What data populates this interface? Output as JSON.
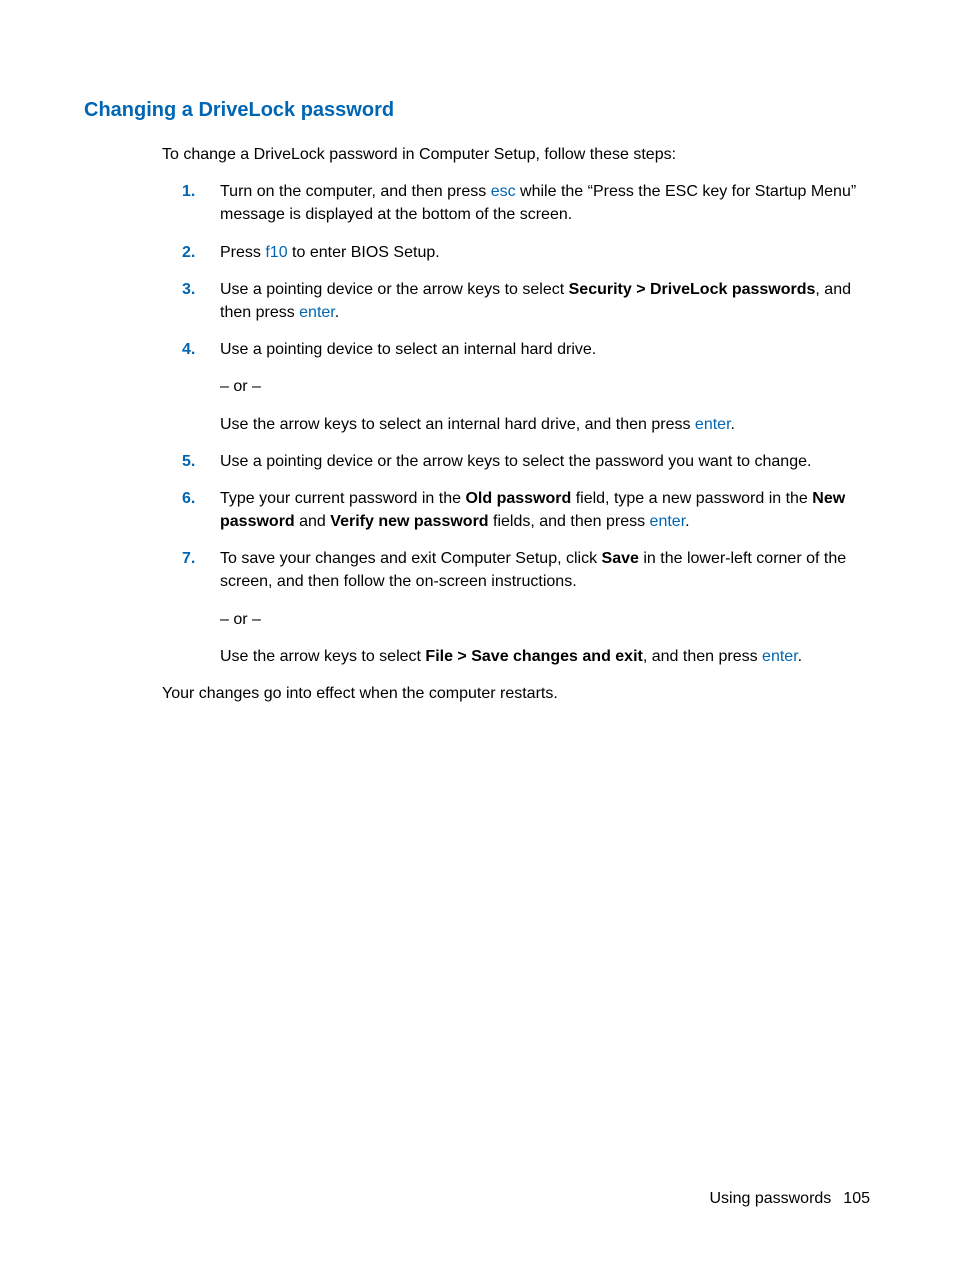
{
  "heading": "Changing a DriveLock password",
  "intro": "To change a DriveLock password in Computer Setup, follow these steps:",
  "keys": {
    "esc": "esc",
    "f10": "f10",
    "enter": "enter"
  },
  "bold": {
    "security_path": "Security > DriveLock passwords",
    "old_password": "Old password",
    "new_password": "New password",
    "verify_new_password": "Verify new password",
    "save": "Save",
    "file_path": "File > Save changes and exit"
  },
  "steps": {
    "s1a": "Turn on the computer, and then press ",
    "s1b": " while the “Press the ESC key for Startup Menu” message is displayed at the bottom of the screen.",
    "s2a": "Press ",
    "s2b": " to enter BIOS Setup.",
    "s3a": "Use a pointing device or the arrow keys to select ",
    "s3b": ", and then press ",
    "s3c": ".",
    "s4a": "Use a pointing device to select an internal hard drive.",
    "s4_or": "– or –",
    "s4b": "Use the arrow keys to select an internal hard drive, and then press ",
    "s4c": ".",
    "s5": "Use a pointing device or the arrow keys to select the password you want to change.",
    "s6a": "Type your current password in the ",
    "s6b": " field, type a new password in the ",
    "s6c": " and ",
    "s6d": " fields, and then press ",
    "s6e": ".",
    "s7a": "To save your changes and exit Computer Setup, click ",
    "s7b": " in the lower-left corner of the screen, and then follow the on-screen instructions.",
    "s7_or": "– or –",
    "s7c": "Use the arrow keys to select ",
    "s7d": ", and then press ",
    "s7e": "."
  },
  "closing": "Your changes go into effect when the computer restarts.",
  "footer": {
    "section": "Using passwords",
    "page": "105"
  }
}
